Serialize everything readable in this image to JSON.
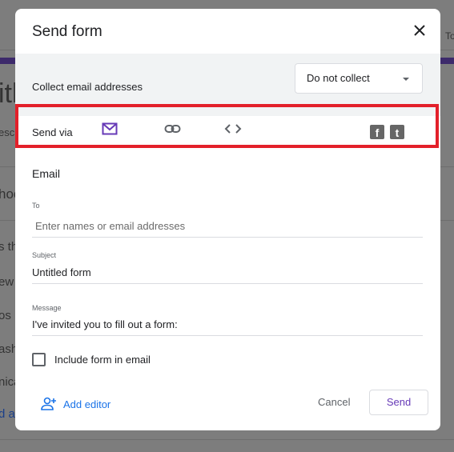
{
  "background": {
    "fragments": [
      "itl",
      "esc",
      "hoc",
      "s th",
      "ew",
      "os ,",
      "ash",
      "nica",
      "d a",
      "To"
    ]
  },
  "dialog": {
    "title": "Send form",
    "close_icon": "close-icon",
    "collect": {
      "label": "Collect email addresses",
      "selected": "Do not collect"
    },
    "send_via": {
      "label": "Send via",
      "tabs": [
        {
          "icon": "email-icon",
          "active": true
        },
        {
          "icon": "link-icon",
          "active": false
        },
        {
          "icon": "embed-code-icon",
          "active": false
        }
      ],
      "social": [
        {
          "icon": "facebook-icon",
          "glyph": "f"
        },
        {
          "icon": "twitter-icon",
          "glyph": "t"
        }
      ]
    },
    "highlight_color": "#e3202a",
    "accent_color": "#673ab7",
    "email": {
      "heading": "Email",
      "to": {
        "label": "To",
        "placeholder": "Enter names or email addresses",
        "value": ""
      },
      "subject": {
        "label": "Subject",
        "value": "Untitled form"
      },
      "message": {
        "label": "Message",
        "value": "I've invited you to fill out a form:"
      },
      "include_form": {
        "label": "Include form in email",
        "checked": false
      }
    },
    "footer": {
      "add_editor": "Add editor",
      "cancel": "Cancel",
      "send": "Send"
    }
  }
}
